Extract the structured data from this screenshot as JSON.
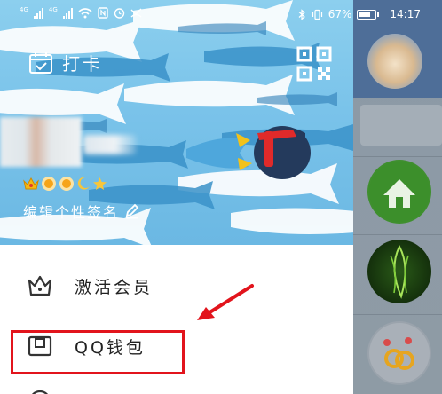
{
  "status_bar": {
    "carrier1": "4G",
    "carrier2": "4G",
    "battery": "67%",
    "time": "14:17",
    "icons": [
      "signal-icon",
      "wifi-icon",
      "nfc-icon",
      "alarm-icon",
      "missed-call-icon",
      "bluetooth-icon",
      "vibrate-icon",
      "battery-icon"
    ]
  },
  "header": {
    "checkin_label": "打卡",
    "checkin_icon": "calendar-check-icon",
    "qr_icon": "qr-code-icon",
    "signature_label": "编辑个性签名",
    "signature_icon": "pencil-icon",
    "level_badges": [
      "crown-icon",
      "sun-icon",
      "sun-icon",
      "moon-icon",
      "star-icon"
    ]
  },
  "menu": {
    "items": [
      {
        "label": "激活会员",
        "icon": "crown-outline-icon"
      },
      {
        "label": "QQ钱包",
        "icon": "wallet-icon"
      }
    ]
  },
  "annotation": {
    "highlight_color": "#e2141c"
  },
  "colors": {
    "header_bg": "#7ac3ea",
    "text_primary": "#222222",
    "overlay": "#8e9ba5"
  }
}
